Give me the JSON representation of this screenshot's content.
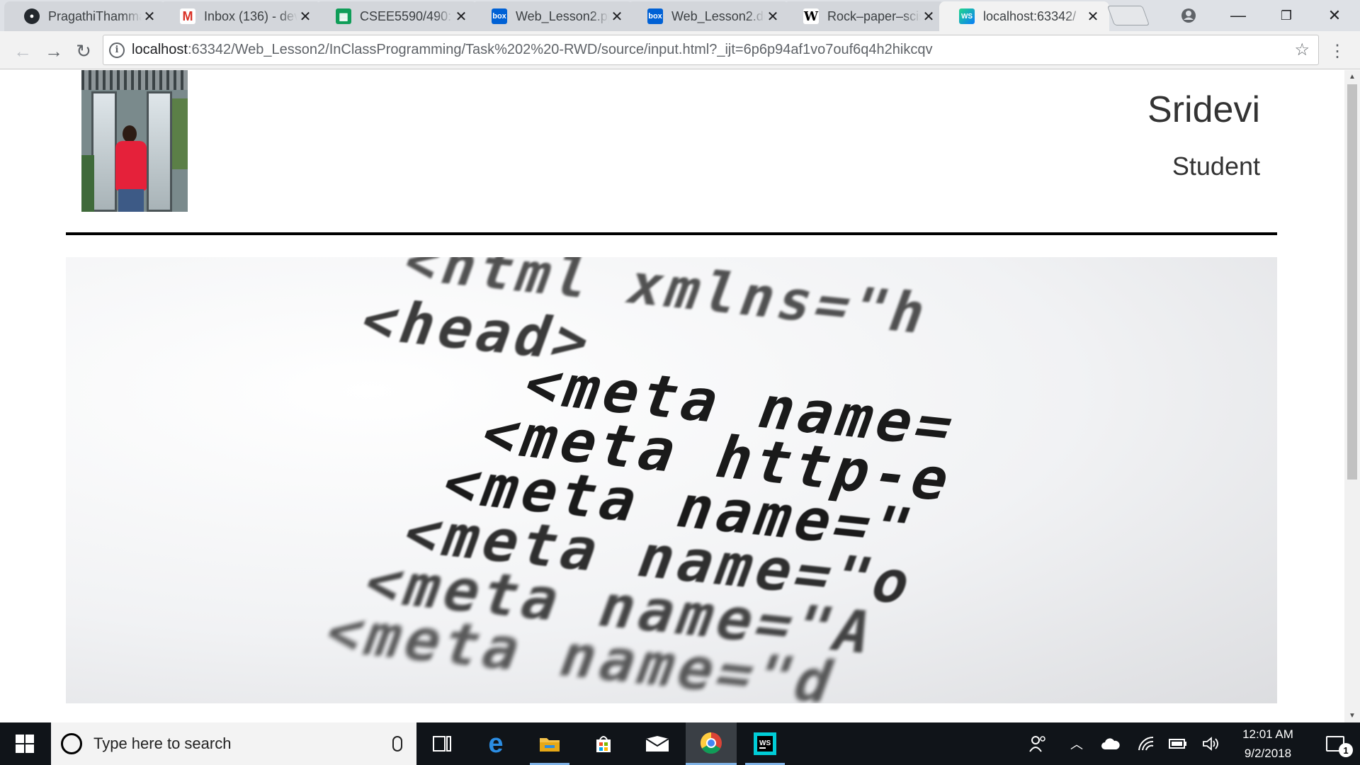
{
  "browser": {
    "tabs": [
      {
        "title": "PragathiThamma",
        "favicon": "github-icon"
      },
      {
        "title": "Inbox (136) - dev",
        "favicon": "gmail-icon"
      },
      {
        "title": "CSEE5590/490: W",
        "favicon": "sheets-icon"
      },
      {
        "title": "Web_Lesson2.pp",
        "favicon": "box-icon"
      },
      {
        "title": "Web_Lesson2.do",
        "favicon": "box-icon"
      },
      {
        "title": "Rock–paper–scis",
        "favicon": "wikipedia-icon"
      },
      {
        "title": "localhost:63342/",
        "favicon": "webstorm-icon",
        "active": true
      }
    ],
    "url_host": "localhost",
    "url_rest": ":63342/Web_Lesson2/InClassProgramming/Task%202%20-RWD/source/input.html?_ijt=6p6p94af1vo7ouf6q4h2hikcqv"
  },
  "page": {
    "name": "Sridevi",
    "role": "Student",
    "hero_code": [
      "<html xmlns=\"h",
      "<head>",
      "<meta name=",
      "<meta http-e",
      "<meta name=\"",
      "<meta name=\"o",
      "<meta name=\"A",
      "<meta name=\"d"
    ]
  },
  "taskbar": {
    "search_placeholder": "Type here to search",
    "time": "12:01 AM",
    "date": "9/2/2018",
    "notification_count": "1"
  },
  "colors": {
    "accent": "#7fb2e5",
    "taskbar": "#101419",
    "tab_strip": "#dee1e6"
  }
}
